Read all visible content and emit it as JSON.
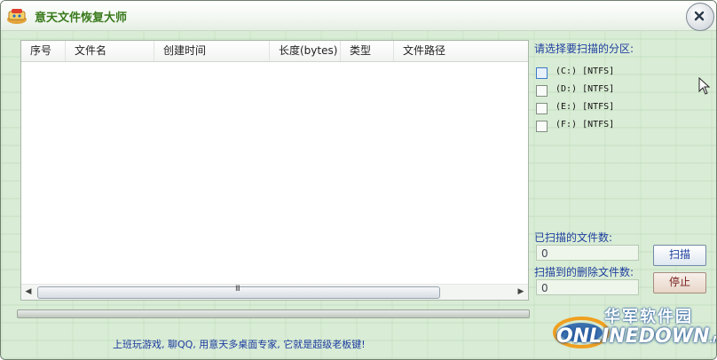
{
  "window": {
    "title": "意天文件恢复大师"
  },
  "list": {
    "columns": [
      "序号",
      "文件名",
      "创建时间",
      "长度(bytes)",
      "类型",
      "文件路径"
    ],
    "scroll_grip": "III"
  },
  "partitions": {
    "title": "请选择要扫描的分区:",
    "drives": [
      {
        "label": "(C:) [NTFS]",
        "checked": false
      },
      {
        "label": "(D:) [NTFS]",
        "checked": false
      },
      {
        "label": "(E:) [NTFS]",
        "checked": false
      },
      {
        "label": "(F:) [NTFS]",
        "checked": false
      }
    ]
  },
  "stats": {
    "scanned_label": "已扫描的文件数:",
    "scanned_value": "0",
    "deleted_label": "扫描到的删除文件数:",
    "deleted_value": "0"
  },
  "buttons": {
    "scan": "扫描",
    "stop": "停止"
  },
  "footer": {
    "text": "上班玩游戏, 聊QQ, 用意天多桌面专家, 它就是超级老板键!"
  },
  "watermark": {
    "cn": "华军软件园",
    "en": "ONLINEDOWN",
    "suffix": ".NET"
  },
  "colors": {
    "title": "#3a7a1c",
    "label": "#1f3fa0",
    "background": "#d9ecd5"
  }
}
